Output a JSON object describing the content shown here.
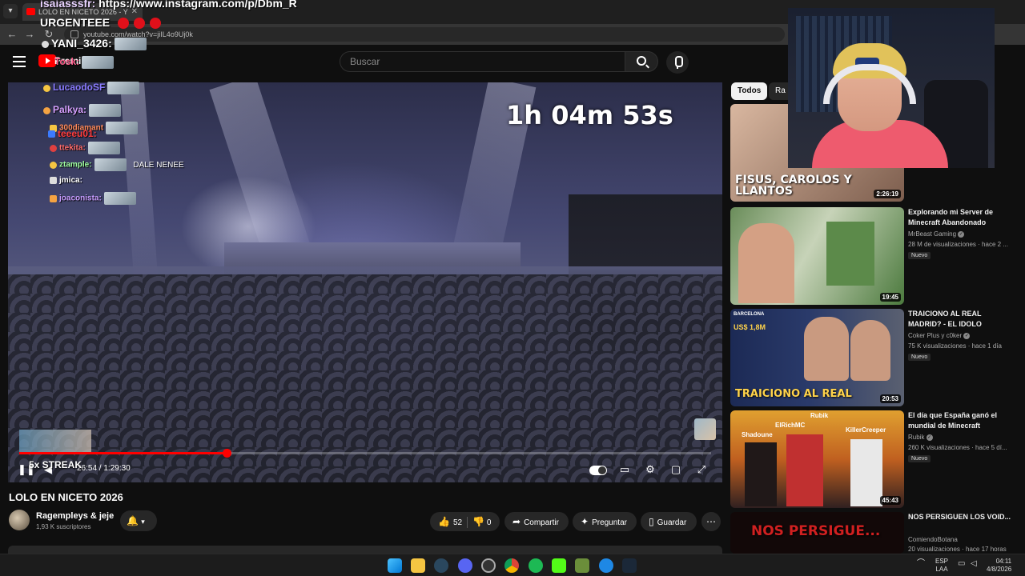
{
  "browser": {
    "tab_title": "LOLO EN NICETO 2026 - Y",
    "url": "youtube.com/watch?v=jiIL4o9Uj0k"
  },
  "header": {
    "logo_text": "Premium",
    "search_placeholder": "Buscar"
  },
  "player": {
    "timer_overlay": "1h 04m 53s",
    "current_time": "26:54",
    "duration": "1:29:30",
    "progress_fraction": 0.3,
    "stream_label": "5x STREAK"
  },
  "chat": [
    {
      "user": "isaiasssfr:",
      "text": "https://www.instagram.com/p/Dbm_R",
      "color": "#e9d3ff"
    },
    {
      "user": "",
      "text": "URGENTEEE",
      "color": "#ffffff"
    },
    {
      "user": "YANI_3426:",
      "text": "",
      "color": "#ffffff"
    },
    {
      "user": "Tosk:",
      "text": "",
      "color": "#ff5b8a"
    },
    {
      "user": "LucaodoSF",
      "text": "",
      "color": "#8a7bff"
    },
    {
      "user": "Palkya:",
      "text": "",
      "color": "#d6a0ff"
    },
    {
      "user": "300diamant",
      "text": "",
      "color": "#ff8a5b"
    },
    {
      "user": "teeeu01:",
      "text": "",
      "color": "#ff3b3b"
    },
    {
      "user": "ttekita:",
      "text": "",
      "color": "#ff6b6b"
    },
    {
      "user": "ztample:",
      "text": "DALE NENEE",
      "color": "#9fff9f"
    },
    {
      "user": "jmica:",
      "text": "",
      "color": "#ffffff"
    },
    {
      "user": "joaconista:",
      "text": "",
      "color": "#c89cff"
    }
  ],
  "video": {
    "title": "LOLO EN NICETO 2026",
    "channel": "Ragempleys & jeje",
    "subscribers": "1,93 K suscriptores",
    "likes": "52",
    "dislikes": "0",
    "share_label": "Compartir",
    "ask_label": "Preguntar",
    "save_label": "Guardar"
  },
  "sidebar": {
    "chips": [
      "Todos",
      "Ra"
    ],
    "recommendations": [
      {
        "title": "",
        "channel": "",
        "views": "",
        "duration": "2:26:19",
        "thumb_text": "FISUS, CAROLOS Y LLANTOS",
        "new": ""
      },
      {
        "title": "Explorando mi Server de Minecraft Abandonado",
        "channel": "MrBeast Gaming",
        "views": "28 M de visualizaciones · hace 2 ...",
        "duration": "19:45",
        "thumb_text": "",
        "new": "Nuevo"
      },
      {
        "title": "TRAICIONO AL REAL MADRID? - EL IDOLO",
        "channel": "Coker Plus y c0ker",
        "views": "75 K visualizaciones · hace 1 día",
        "duration": "20:53",
        "thumb_text": "TRAICIONO AL REAL",
        "new": "Nuevo"
      },
      {
        "title": "El día que España ganó el mundial de Minecraft",
        "channel": "Rubik",
        "views": "260 K visualizaciones · hace 5 dí...",
        "duration": "45:43",
        "thumb_text": "",
        "new": "Nuevo"
      },
      {
        "title": "NOS PERSIGUEN LOS VOID...",
        "channel": "ComiendoBotana",
        "views": "20 visualizaciones · hace 17 horas",
        "duration": "",
        "thumb_text": "NOS PERSIGUE...",
        "new": ""
      }
    ]
  },
  "thumbnail_labels": {
    "barcelona": "BARCELONA",
    "price": "US$ 1,8M",
    "names": [
      "Rubik",
      "Shadoune",
      "ElRichMC",
      "KillerCreeper"
    ]
  },
  "taskbar": {
    "lang": "ESP",
    "lang2": "LAA",
    "time": "04:11",
    "date": "4/8/2026"
  }
}
